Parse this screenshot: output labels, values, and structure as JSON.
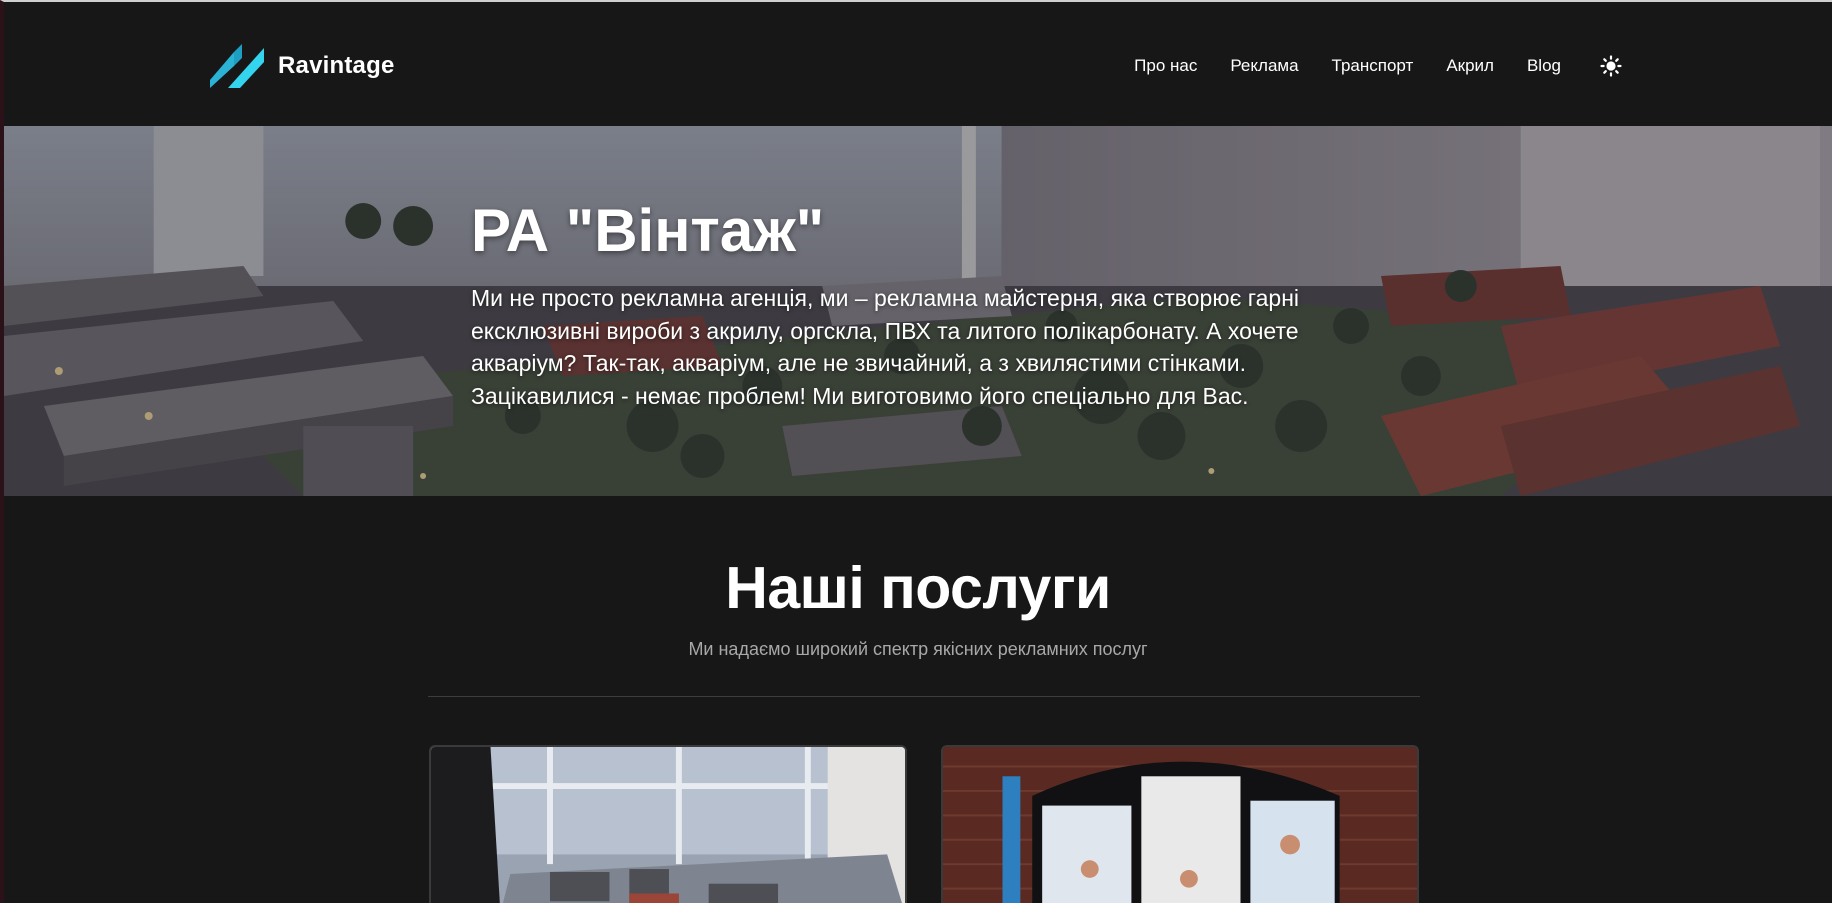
{
  "brand": {
    "name": "Ravintage",
    "logo_icon": "double-slash-logo-icon",
    "accent_color": "#29c9e6"
  },
  "nav": {
    "items": [
      {
        "label": "Про нас"
      },
      {
        "label": "Реклама"
      },
      {
        "label": "Транспорт"
      },
      {
        "label": "Акрил"
      },
      {
        "label": "Blog"
      }
    ],
    "theme_toggle_icon": "sun-icon"
  },
  "hero": {
    "title": "РА \"Вінтаж\"",
    "text": "Ми не просто рекламна агенція, ми – рекламна майстерня, яка створює гарні ексклюзивні вироби з акрилу, оргскла, ПВХ та литого полікарбонату. А хочете акваріум? Так-так, акваріум, але не звичайний, а з хвилястими стінками. Зацікавилися - немає проблем! Ми виготовимо його спеціально для Вас.",
    "background": "architectural-model-photo"
  },
  "services": {
    "title": "Наші послуги",
    "subtitle": "Ми надаємо широкий спектр якісних рекламних послуг",
    "cards": [
      {
        "image": "architectural-model-photo"
      },
      {
        "image": "storefront-display-photo"
      }
    ]
  }
}
